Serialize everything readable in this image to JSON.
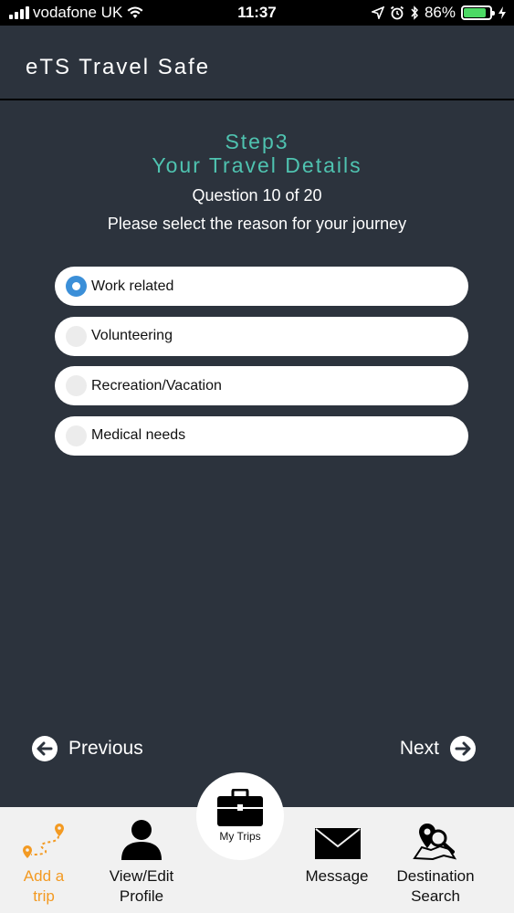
{
  "status_bar": {
    "carrier": "vodafone UK",
    "time": "11:37",
    "battery": "86%",
    "battery_level": 0.86
  },
  "header": {
    "title": "eTS Travel Safe"
  },
  "step": {
    "line1": "Step3",
    "line2": "Your Travel Details"
  },
  "question": {
    "count": "Question 10 of 20",
    "text": "Please select the reason for your journey"
  },
  "options": [
    {
      "label": "Work related",
      "selected": true
    },
    {
      "label": "Volunteering",
      "selected": false
    },
    {
      "label": "Recreation/Vacation",
      "selected": false
    },
    {
      "label": "Medical needs",
      "selected": false
    }
  ],
  "navigation": {
    "previous": "Previous",
    "next": "Next"
  },
  "tabs": {
    "add_trip": {
      "line1": "Add a",
      "line2": "trip",
      "icon": "route-pin-icon"
    },
    "profile": {
      "line1": "View/Edit",
      "line2": "Profile",
      "icon": "person-icon"
    },
    "my_trips": {
      "label": "My Trips",
      "icon": "briefcase-icon"
    },
    "message": {
      "label": "Message",
      "icon": "envelope-icon"
    },
    "destination": {
      "line1": "Destination",
      "line2": "Search",
      "icon": "map-search-icon"
    }
  },
  "colors": {
    "background": "#2c333d",
    "accent_teal": "#4fc3b0",
    "radio_selected": "#3b8fd8",
    "active_tab": "#f39a22"
  }
}
